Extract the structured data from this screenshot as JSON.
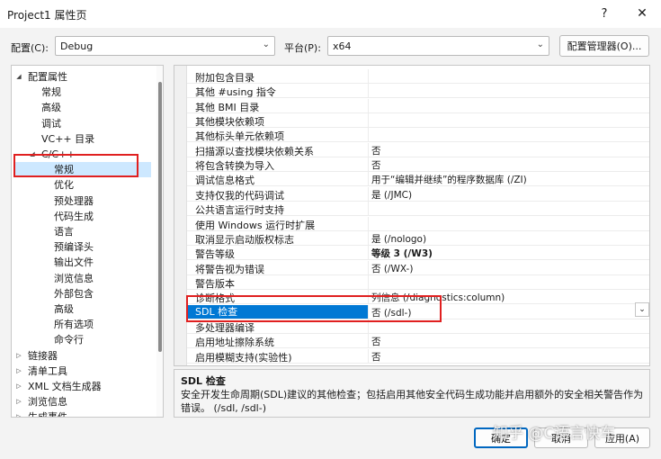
{
  "window": {
    "title": "Project1 属性页",
    "help_label": "?",
    "close_label": "✕"
  },
  "config": {
    "config_label": "配置(C):",
    "config_value": "Debug",
    "platform_label": "平台(P):",
    "platform_value": "x64",
    "manager_label": "配置管理器(O)..."
  },
  "tree": {
    "items": [
      {
        "label": "配置属性",
        "exp": "◢"
      },
      {
        "label": "常规"
      },
      {
        "label": "高级"
      },
      {
        "label": "调试"
      },
      {
        "label": "VC++ 目录"
      },
      {
        "label": "C/C++",
        "exp": "◢"
      },
      {
        "label": "常规"
      },
      {
        "label": "优化"
      },
      {
        "label": "预处理器"
      },
      {
        "label": "代码生成"
      },
      {
        "label": "语言"
      },
      {
        "label": "预编译头"
      },
      {
        "label": "输出文件"
      },
      {
        "label": "浏览信息"
      },
      {
        "label": "外部包含"
      },
      {
        "label": "高级"
      },
      {
        "label": "所有选项"
      },
      {
        "label": "命令行"
      },
      {
        "label": "链接器",
        "exp": "▷"
      },
      {
        "label": "清单工具",
        "exp": "▷"
      },
      {
        "label": "XML 文档生成器",
        "exp": "▷"
      },
      {
        "label": "浏览信息",
        "exp": "▷"
      },
      {
        "label": "生成事件",
        "exp": "▷"
      }
    ]
  },
  "grid": {
    "rows": [
      {
        "name": "附加包含目录",
        "value": ""
      },
      {
        "name": "其他 #using 指令",
        "value": ""
      },
      {
        "name": "其他 BMI 目录",
        "value": ""
      },
      {
        "name": "其他模块依赖项",
        "value": ""
      },
      {
        "name": "其他标头单元依赖项",
        "value": ""
      },
      {
        "name": "扫描源以查找模块依赖关系",
        "value": "否"
      },
      {
        "name": "将包含转换为导入",
        "value": "否"
      },
      {
        "name": "调试信息格式",
        "value": "用于“编辑并继续”的程序数据库 (/ZI)"
      },
      {
        "name": "支持仅我的代码调试",
        "value": "是 (/JMC)"
      },
      {
        "name": "公共语言运行时支持",
        "value": ""
      },
      {
        "name": "使用 Windows 运行时扩展",
        "value": ""
      },
      {
        "name": "取消显示启动版权标志",
        "value": "是 (/nologo)"
      },
      {
        "name": "警告等级",
        "value": "等级 3 (/W3)"
      },
      {
        "name": "将警告视为错误",
        "value": "否 (/WX-)"
      },
      {
        "name": "警告版本",
        "value": ""
      },
      {
        "name": "诊断格式",
        "value": "列信息 (/diagnostics:column)"
      },
      {
        "name": "SDL 检查",
        "value": "否 (/sdl-)"
      },
      {
        "name": "多处理器编译",
        "value": ""
      },
      {
        "name": "启用地址擦除系统",
        "value": "否"
      },
      {
        "name": "启用模糊支持(实验性)",
        "value": "否"
      }
    ],
    "dropdown_icon": "⌄"
  },
  "description": {
    "title": "SDL 检查",
    "text": "安全开发生命周期(SDL)建议的其他检查；包括启用其他安全代码生成功能并启用额外的安全相关警告作为错误。    (/sdl, /sdl-)"
  },
  "buttons": {
    "ok": "确定",
    "cancel": "取消",
    "apply": "应用(A)"
  },
  "watermark": "知乎 @C语言快车",
  "colors": {
    "selection": "#0078d4",
    "tree_selection": "#cde8ff",
    "highlight_box": "#e02020"
  }
}
